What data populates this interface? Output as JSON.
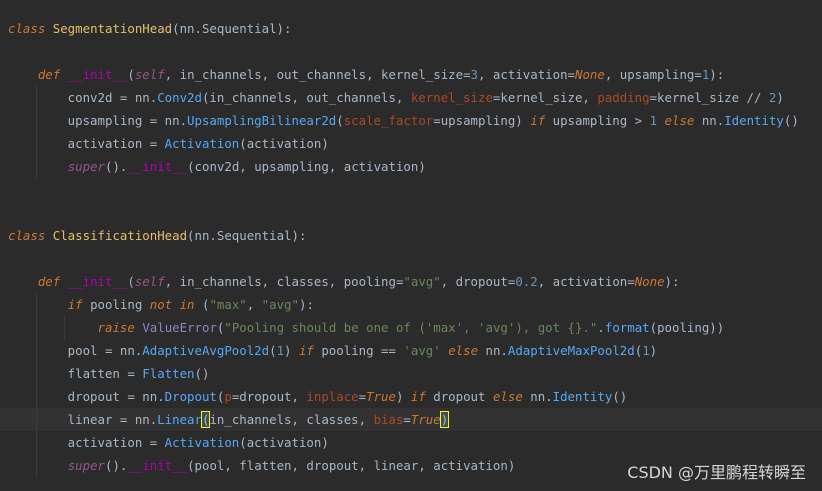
{
  "editor": {
    "lines": [
      {
        "parts": [
          {
            "k": "kwi",
            "t": "class "
          },
          {
            "k": "cls",
            "t": "SegmentationHead"
          },
          {
            "k": "plain",
            "t": "(nn.Sequential):"
          }
        ]
      },
      {
        "parts": []
      },
      {
        "parts": [
          {
            "k": "plain",
            "t": "    "
          },
          {
            "k": "kwi",
            "t": "def "
          },
          {
            "k": "dund",
            "t": "__init__"
          },
          {
            "k": "plain",
            "t": "("
          },
          {
            "k": "self",
            "t": "self"
          },
          {
            "k": "plain",
            "t": ", in_channels, out_channels, kernel_size="
          },
          {
            "k": "num",
            "t": "3"
          },
          {
            "k": "plain",
            "t": ", activation="
          },
          {
            "k": "const",
            "t": "None"
          },
          {
            "k": "plain",
            "t": ", upsampling="
          },
          {
            "k": "num",
            "t": "1"
          },
          {
            "k": "plain",
            "t": "):"
          }
        ]
      },
      {
        "parts": [
          {
            "k": "plain",
            "t": "        conv2d = nn."
          },
          {
            "k": "call",
            "t": "Conv2d"
          },
          {
            "k": "plain",
            "t": "(in_channels, out_channels, "
          },
          {
            "k": "pk",
            "t": "kernel_size"
          },
          {
            "k": "plain",
            "t": "=kernel_size, "
          },
          {
            "k": "pk",
            "t": "padding"
          },
          {
            "k": "plain",
            "t": "=kernel_size // "
          },
          {
            "k": "num",
            "t": "2"
          },
          {
            "k": "plain",
            "t": ")"
          }
        ]
      },
      {
        "parts": [
          {
            "k": "plain",
            "t": "        upsampling = nn."
          },
          {
            "k": "call",
            "t": "UpsamplingBilinear2d"
          },
          {
            "k": "plain",
            "t": "("
          },
          {
            "k": "pk",
            "t": "scale_factor"
          },
          {
            "k": "plain",
            "t": "=upsampling) "
          },
          {
            "k": "kwi",
            "t": "if"
          },
          {
            "k": "plain",
            "t": " upsampling > "
          },
          {
            "k": "num",
            "t": "1"
          },
          {
            "k": "plain",
            "t": " "
          },
          {
            "k": "kwi",
            "t": "else"
          },
          {
            "k": "plain",
            "t": " nn."
          },
          {
            "k": "call",
            "t": "Identity"
          },
          {
            "k": "plain",
            "t": "()"
          }
        ]
      },
      {
        "parts": [
          {
            "k": "plain",
            "t": "        activation = "
          },
          {
            "k": "call",
            "t": "Activation"
          },
          {
            "k": "plain",
            "t": "(activation)"
          }
        ]
      },
      {
        "parts": [
          {
            "k": "plain",
            "t": "        "
          },
          {
            "k": "self",
            "t": "super"
          },
          {
            "k": "plain",
            "t": "()."
          },
          {
            "k": "dund",
            "t": "__init__"
          },
          {
            "k": "plain",
            "t": "(conv2d, upsampling, activation)"
          }
        ]
      },
      {
        "parts": []
      },
      {
        "parts": []
      },
      {
        "parts": [
          {
            "k": "kwi",
            "t": "class "
          },
          {
            "k": "cls",
            "t": "ClassificationHead"
          },
          {
            "k": "plain",
            "t": "(nn.Sequential):"
          }
        ]
      },
      {
        "parts": []
      },
      {
        "parts": [
          {
            "k": "plain",
            "t": "    "
          },
          {
            "k": "kwi",
            "t": "def "
          },
          {
            "k": "dund",
            "t": "__init__"
          },
          {
            "k": "plain",
            "t": "("
          },
          {
            "k": "self",
            "t": "self"
          },
          {
            "k": "plain",
            "t": ", in_channels, classes, pooling="
          },
          {
            "k": "str",
            "t": "\"avg\""
          },
          {
            "k": "plain",
            "t": ", dropout="
          },
          {
            "k": "num",
            "t": "0.2"
          },
          {
            "k": "plain",
            "t": ", activation="
          },
          {
            "k": "const",
            "t": "None"
          },
          {
            "k": "plain",
            "t": "):"
          }
        ]
      },
      {
        "parts": [
          {
            "k": "plain",
            "t": "        "
          },
          {
            "k": "kwi",
            "t": "if"
          },
          {
            "k": "plain",
            "t": " pooling "
          },
          {
            "k": "kwi",
            "t": "not in"
          },
          {
            "k": "plain",
            "t": " ("
          },
          {
            "k": "str",
            "t": "\"max\""
          },
          {
            "k": "plain",
            "t": ", "
          },
          {
            "k": "str",
            "t": "\"avg\""
          },
          {
            "k": "plain",
            "t": "):"
          }
        ]
      },
      {
        "parts": [
          {
            "k": "plain",
            "t": "            "
          },
          {
            "k": "kwi",
            "t": "raise"
          },
          {
            "k": "plain",
            "t": " "
          },
          {
            "k": "bi",
            "t": "ValueError"
          },
          {
            "k": "plain",
            "t": "("
          },
          {
            "k": "str",
            "t": "\"Pooling should be one of ('max', 'avg'), got {}.\""
          },
          {
            "k": "plain",
            "t": "."
          },
          {
            "k": "call",
            "t": "format"
          },
          {
            "k": "plain",
            "t": "(pooling))"
          }
        ]
      },
      {
        "parts": [
          {
            "k": "plain",
            "t": "        pool = nn."
          },
          {
            "k": "call",
            "t": "AdaptiveAvgPool2d"
          },
          {
            "k": "plain",
            "t": "("
          },
          {
            "k": "num",
            "t": "1"
          },
          {
            "k": "plain",
            "t": ") "
          },
          {
            "k": "kwi",
            "t": "if"
          },
          {
            "k": "plain",
            "t": " pooling == "
          },
          {
            "k": "str",
            "t": "'avg'"
          },
          {
            "k": "plain",
            "t": " "
          },
          {
            "k": "kwi",
            "t": "else"
          },
          {
            "k": "plain",
            "t": " nn."
          },
          {
            "k": "call",
            "t": "AdaptiveMaxPool2d"
          },
          {
            "k": "plain",
            "t": "("
          },
          {
            "k": "num",
            "t": "1"
          },
          {
            "k": "plain",
            "t": ")"
          }
        ]
      },
      {
        "parts": [
          {
            "k": "plain",
            "t": "        flatten = "
          },
          {
            "k": "call",
            "t": "Flatten"
          },
          {
            "k": "plain",
            "t": "()"
          }
        ]
      },
      {
        "parts": [
          {
            "k": "plain",
            "t": "        dropout = nn."
          },
          {
            "k": "call",
            "t": "Dropout"
          },
          {
            "k": "plain",
            "t": "("
          },
          {
            "k": "pk",
            "t": "p"
          },
          {
            "k": "plain",
            "t": "=dropout, "
          },
          {
            "k": "pk",
            "t": "inplace"
          },
          {
            "k": "plain",
            "t": "="
          },
          {
            "k": "const",
            "t": "True"
          },
          {
            "k": "plain",
            "t": ") "
          },
          {
            "k": "kwi",
            "t": "if"
          },
          {
            "k": "plain",
            "t": " dropout "
          },
          {
            "k": "kwi",
            "t": "else"
          },
          {
            "k": "plain",
            "t": " nn."
          },
          {
            "k": "call",
            "t": "Identity"
          },
          {
            "k": "plain",
            "t": "()"
          }
        ]
      },
      {
        "current": true,
        "parts": [
          {
            "k": "plain",
            "t": "        linear = nn."
          },
          {
            "k": "call",
            "t": "Linear"
          },
          {
            "k": "brace",
            "t": "("
          },
          {
            "k": "plain",
            "t": "in_channels, classes, "
          },
          {
            "k": "pk",
            "t": "bias"
          },
          {
            "k": "plain",
            "t": "="
          },
          {
            "k": "const",
            "t": "True"
          },
          {
            "k": "brace",
            "t": ")"
          }
        ]
      },
      {
        "parts": [
          {
            "k": "plain",
            "t": "        activation = "
          },
          {
            "k": "call",
            "t": "Activation"
          },
          {
            "k": "plain",
            "t": "(activation)"
          }
        ]
      },
      {
        "parts": [
          {
            "k": "plain",
            "t": "        "
          },
          {
            "k": "self",
            "t": "super"
          },
          {
            "k": "plain",
            "t": "()."
          },
          {
            "k": "dund",
            "t": "__init__"
          },
          {
            "k": "plain",
            "t": "(pool, flatten, dropout, linear, activation)"
          }
        ]
      }
    ]
  },
  "watermark": "CSDN @万里鹏程转瞬至"
}
